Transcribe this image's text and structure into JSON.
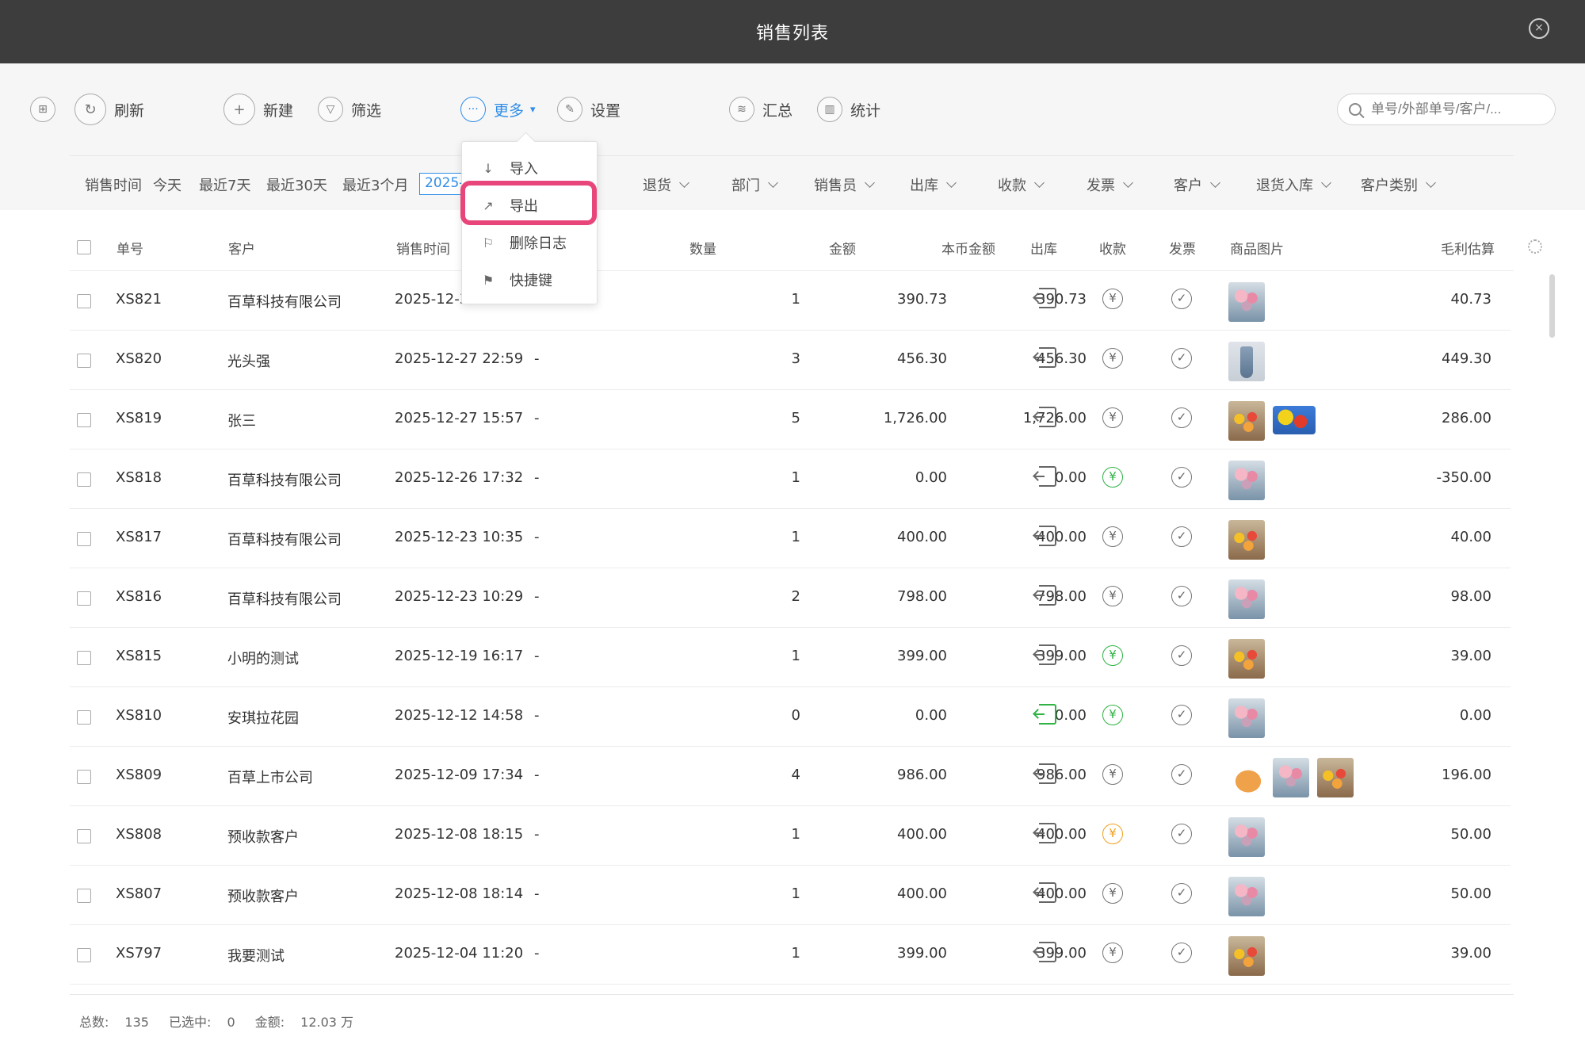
{
  "window": {
    "title": "销售列表",
    "close_icon": "×"
  },
  "toolbar": {
    "refresh": "刷新",
    "new": "新建",
    "filter": "筛选",
    "more": "更多",
    "settings": "设置",
    "summary": "汇总",
    "statistics": "统计",
    "search_placeholder": "单号/外部单号/客户/..."
  },
  "more_menu": {
    "import": "导入",
    "export": "导出",
    "delete_log": "删除日志",
    "shortcuts": "快捷键"
  },
  "filters": {
    "time_label": "销售时间",
    "today": "今天",
    "last7": "最近7天",
    "last30": "最近30天",
    "last3m": "最近3个月",
    "date_value": "2025-",
    "dropdowns": [
      "退货",
      "部门",
      "销售员",
      "出库",
      "收款",
      "发票",
      "客户",
      "退货入库",
      "客户类别"
    ]
  },
  "table": {
    "headers": {
      "order_no": "单号",
      "customer": "客户",
      "time": "销售时间",
      "qty": "数量",
      "amount": "金额",
      "local_amount": "本币金额",
      "outbound": "出库",
      "payment": "收款",
      "invoice": "发票",
      "images": "商品图片",
      "gross_profit": "毛利估算"
    },
    "rows": [
      {
        "no": "XS821",
        "customer": "百草科技有限公司",
        "time": "2025-12-30",
        "ext": "",
        "qty": "1",
        "amount": "390.73",
        "local": "390.73",
        "out": "gray",
        "pay": "gray",
        "images": [
          "roses"
        ],
        "profit": "40.73"
      },
      {
        "no": "XS820",
        "customer": "光头强",
        "time": "2025-12-27 22:59",
        "ext": "-",
        "qty": "3",
        "amount": "456.30",
        "local": "456.30",
        "out": "gray",
        "pay": "gray",
        "images": [
          "dress"
        ],
        "profit": "449.30"
      },
      {
        "no": "XS819",
        "customer": "张三",
        "time": "2025-12-27 15:57",
        "ext": "-",
        "qty": "5",
        "amount": "1,726.00",
        "local": "1,726.00",
        "out": "gray",
        "pay": "gray",
        "images": [
          "sun",
          "toy"
        ],
        "profit": "286.00"
      },
      {
        "no": "XS818",
        "customer": "百草科技有限公司",
        "time": "2025-12-26 17:32",
        "ext": "-",
        "qty": "1",
        "amount": "0.00",
        "local": "0.00",
        "out": "gray",
        "pay": "green",
        "images": [
          "roses"
        ],
        "profit": "-350.00"
      },
      {
        "no": "XS817",
        "customer": "百草科技有限公司",
        "time": "2025-12-23 10:35",
        "ext": "-",
        "qty": "1",
        "amount": "400.00",
        "local": "400.00",
        "out": "gray",
        "pay": "gray",
        "images": [
          "sun"
        ],
        "profit": "40.00"
      },
      {
        "no": "XS816",
        "customer": "百草科技有限公司",
        "time": "2025-12-23 10:29",
        "ext": "-",
        "qty": "2",
        "amount": "798.00",
        "local": "798.00",
        "out": "gray",
        "pay": "gray",
        "images": [
          "roses"
        ],
        "profit": "98.00"
      },
      {
        "no": "XS815",
        "customer": "小明的测试",
        "time": "2025-12-19 16:17",
        "ext": "-",
        "qty": "1",
        "amount": "399.00",
        "local": "399.00",
        "out": "gray",
        "pay": "green",
        "images": [
          "sun"
        ],
        "profit": "39.00"
      },
      {
        "no": "XS810",
        "customer": "安琪拉花园",
        "time": "2025-12-12 14:58",
        "ext": "-",
        "qty": "0",
        "amount": "0.00",
        "local": "0.00",
        "out": "green",
        "pay": "green",
        "images": [
          "roses"
        ],
        "profit": "0.00"
      },
      {
        "no": "XS809",
        "customer": "百草上市公司",
        "time": "2025-12-09 17:34",
        "ext": "-",
        "qty": "4",
        "amount": "986.00",
        "local": "986.00",
        "out": "gray",
        "pay": "gray",
        "images": [
          "hat",
          "roses",
          "sun"
        ],
        "profit": "196.00"
      },
      {
        "no": "XS808",
        "customer": "预收款客户",
        "time": "2025-12-08 18:15",
        "ext": "-",
        "qty": "1",
        "amount": "400.00",
        "local": "400.00",
        "out": "gray",
        "pay": "orange",
        "images": [
          "roses"
        ],
        "profit": "50.00"
      },
      {
        "no": "XS807",
        "customer": "预收款客户",
        "time": "2025-12-08 18:14",
        "ext": "-",
        "qty": "1",
        "amount": "400.00",
        "local": "400.00",
        "out": "gray",
        "pay": "gray",
        "images": [
          "roses"
        ],
        "profit": "50.00"
      },
      {
        "no": "XS797",
        "customer": "我要测试",
        "time": "2025-12-04 11:20",
        "ext": "-",
        "qty": "1",
        "amount": "399.00",
        "local": "399.00",
        "out": "gray",
        "pay": "gray",
        "images": [
          "sun"
        ],
        "profit": "39.00"
      }
    ]
  },
  "footer": {
    "total_label": "总数:",
    "total": "135",
    "selected_label": "已选中:",
    "selected": "0",
    "amount_label": "金额:",
    "amount": "12.03 万"
  },
  "colors": {
    "accent": "#2f8ee8",
    "highlight": "#e8457a",
    "green": "#2fb344",
    "orange": "#f0a020",
    "titlebar": "#3d3d3d"
  }
}
